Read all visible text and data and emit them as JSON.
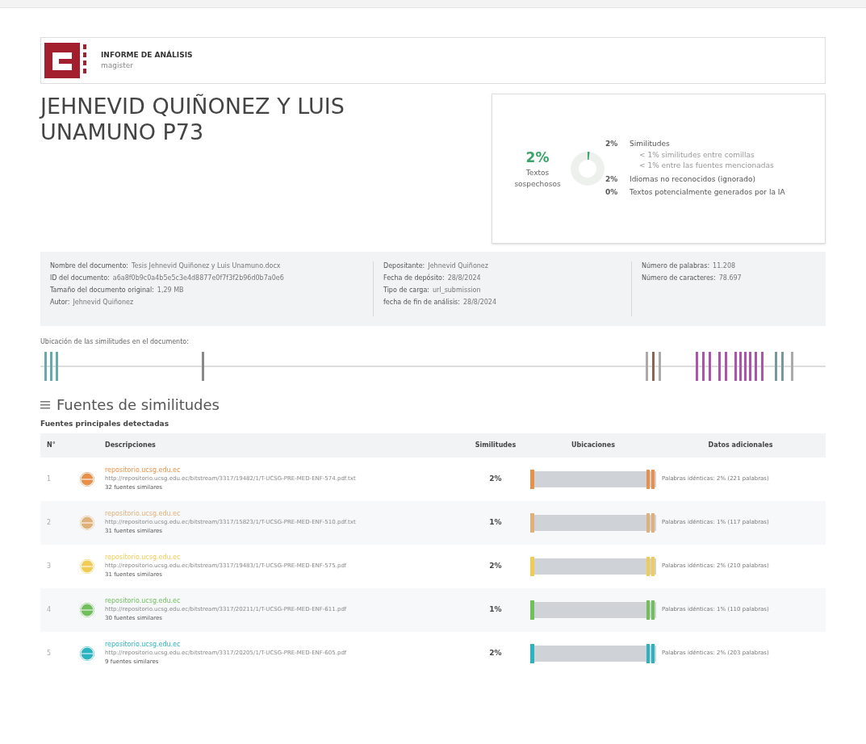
{
  "header": {
    "title": "INFORME DE ANÁLISIS",
    "subtitle": "magister"
  },
  "document_title": "JEHNEVID QUIÑONEZ Y LUIS UNAMUNO P73",
  "summary": {
    "percent": "2%",
    "label": "Textos sospechosos",
    "items": [
      {
        "percent": "2%",
        "label": "Similitudes",
        "children": [
          {
            "text": "< 1% similitudes entre comillas"
          },
          {
            "text": "< 1% entre las fuentes mencionadas"
          }
        ]
      },
      {
        "percent": "2%",
        "label": "Idiomas no reconocidos (ignorado)"
      },
      {
        "percent": "0%",
        "label": "Textos potencialmente generados por la IA"
      }
    ]
  },
  "metadata": [
    [
      {
        "label": "Nombre del documento:",
        "value": "Tesis Jehnevid Quiñonez y Luis Unamuno.docx"
      },
      {
        "label": "ID del documento:",
        "value": "a6a8f0b9c0a4b5e5c3e4d8877e0f7f3f2b96d0b7a0e6"
      },
      {
        "label": "Tamaño del documento original:",
        "value": "1,29 MB"
      },
      {
        "label": "Autor:",
        "value": "Jehnevid Quiñonez"
      }
    ],
    [
      {
        "label": "Depositante:",
        "value": "Jehnevid Quiñonez"
      },
      {
        "label": "Fecha de depósito:",
        "value": "28/8/2024"
      },
      {
        "label": "Tipo de carga:",
        "value": "url_submission"
      },
      {
        "label": "fecha de fin de análisis:",
        "value": "28/8/2024"
      }
    ],
    [
      {
        "label": "Número de palabras:",
        "value": "11.208"
      },
      {
        "label": "Número de caracteres:",
        "value": "78.697"
      }
    ]
  ],
  "locations_label": "Ubicación de las similitudes en el documento:",
  "sources": {
    "title": "Fuentes de similitudes",
    "subtitle": "Fuentes principales detectadas",
    "columns": [
      "N°",
      "Descripciones",
      "Similitudes",
      "Ubicaciones",
      "Datos adicionales"
    ],
    "rows": [
      {
        "number": "1",
        "color": "#e8904a",
        "site": "repositorio.ucsg.edu.ec",
        "url": "http://repositorio.ucsg.edu.ec/bitstream/3317/19482/1/T-UCSG-PRE-MED-ENF-574.pdf.txt",
        "similar": "32 fuentes similares",
        "similarity": "2%",
        "data": "Palabras idénticas: 2% (221 palabras)"
      },
      {
        "number": "2",
        "color": "#e0b07a",
        "site": "repositorio.ucsg.edu.ec",
        "url": "http://repositorio.ucsg.edu.ec/bitstream/3317/15823/1/T-UCSG-PRE-MED-ENF-510.pdf.txt",
        "similar": "31 fuentes similares",
        "similarity": "1%",
        "data": "Palabras idénticas: 1% (117 palabras)"
      },
      {
        "number": "3",
        "color": "#f0cc55",
        "site": "repositorio.ucsg.edu.ec",
        "url": "http://repositorio.ucsg.edu.ec/bitstream/3317/19483/1/T-UCSG-PRE-MED-ENF-575.pdf",
        "similar": "31 fuentes similares",
        "similarity": "2%",
        "data": "Palabras idénticas: 2% (210 palabras)"
      },
      {
        "number": "4",
        "color": "#6fbf5a",
        "site": "repositorio.ucsg.edu.ec",
        "url": "http://repositorio.ucsg.edu.ec/bitstream/3317/20211/1/T-UCSG-PRE-MED-ENF-611.pdf",
        "similar": "30 fuentes similares",
        "similarity": "1%",
        "data": "Palabras idénticas: 1% (110 palabras)"
      },
      {
        "number": "5",
        "color": "#2bb3c0",
        "site": "repositorio.ucsg.edu.ec",
        "url": "http://repositorio.ucsg.edu.ec/bitstream/3317/20205/1/T-UCSG-PRE-MED-ENF-605.pdf",
        "similar": "9 fuentes similares",
        "similarity": "2%",
        "data": "Palabras idénticas: 2% (203 palabras)"
      }
    ]
  }
}
